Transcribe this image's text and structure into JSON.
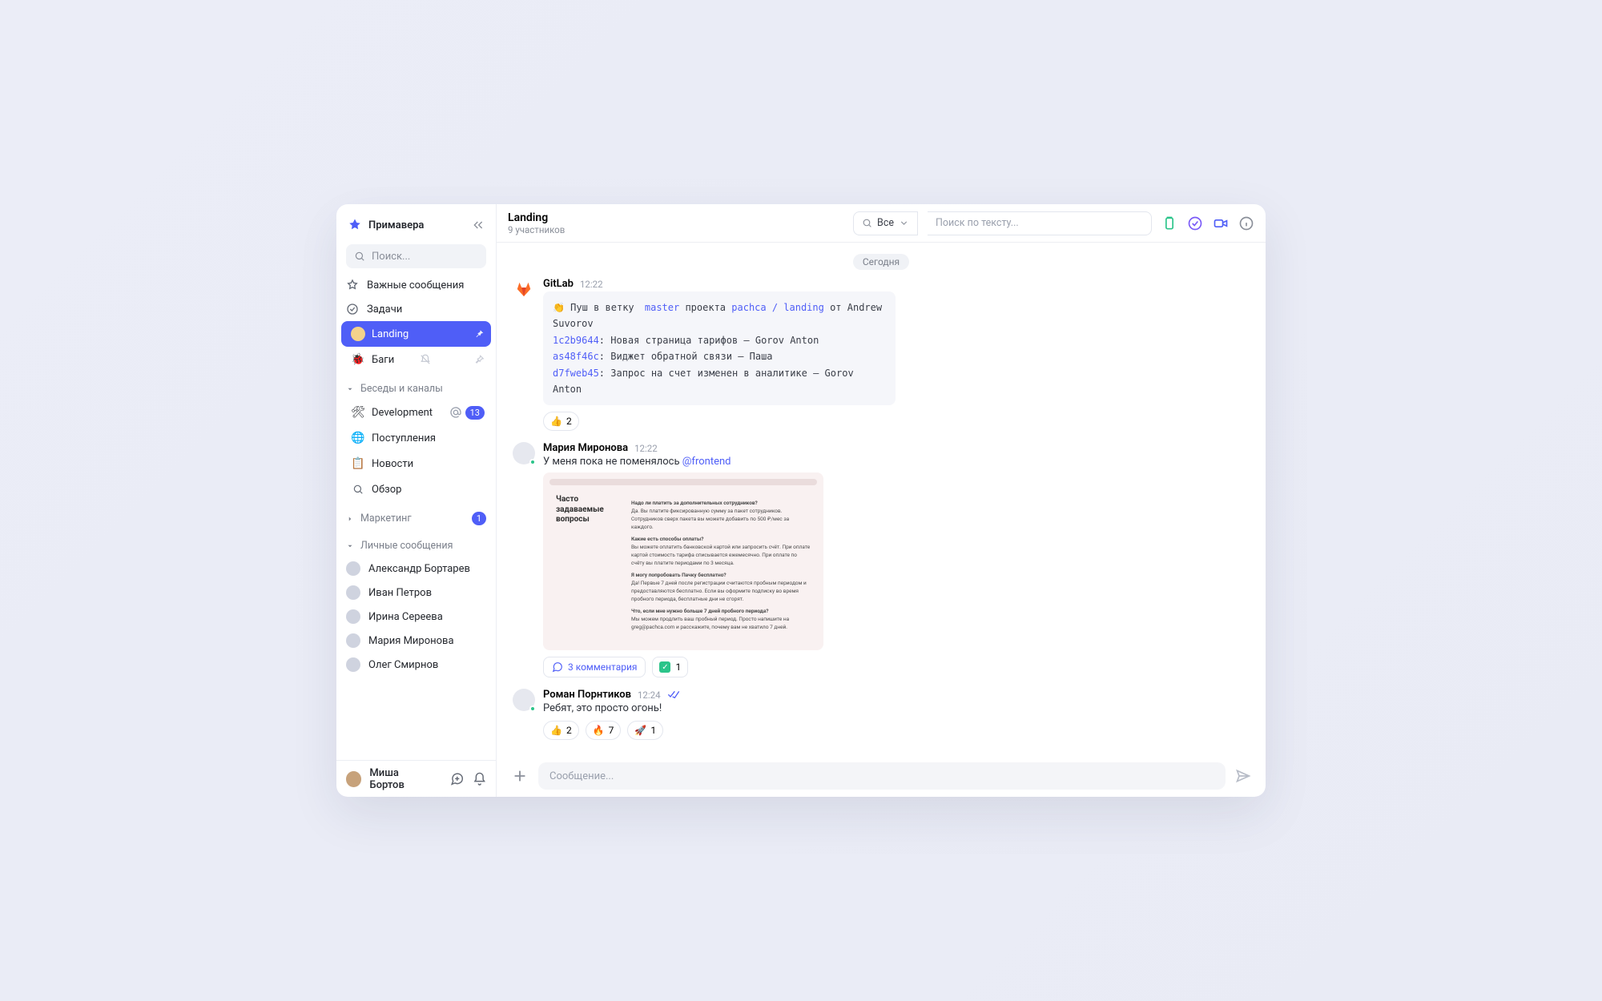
{
  "workspace": {
    "name": "Примавера"
  },
  "sidebar": {
    "search_placeholder": "Поиск...",
    "important": "Важные сообщения",
    "tasks": "Задачи",
    "section_channels": "Беседы и каналы",
    "section_marketing": "Маркетинг",
    "section_dm": "Личные сообщения",
    "channels": {
      "landing": {
        "label": "Landing",
        "emoji": "🌕"
      },
      "bugs": {
        "label": "Баги",
        "emoji": "🐞"
      },
      "dev": {
        "label": "Development",
        "emoji": "🛠",
        "badge": "13"
      },
      "inbox": {
        "label": "Поступления",
        "emoji": "🌐"
      },
      "news": {
        "label": "Новости",
        "emoji": "📋"
      },
      "review": {
        "label": "Обзор",
        "emoji": ""
      }
    },
    "marketing_badge": "1",
    "dms": [
      {
        "name": "Александр Бортарев"
      },
      {
        "name": "Иван Петров"
      },
      {
        "name": "Ирина Сереева"
      },
      {
        "name": "Мария Миронова"
      },
      {
        "name": "Олег Смирнов"
      }
    ],
    "me": "Миша Бортов"
  },
  "header": {
    "title": "Landing",
    "subtitle": "9 участников",
    "filter_label": "Все",
    "search_placeholder": "Поиск по тексту..."
  },
  "day_label": "Сегодня",
  "messages": {
    "gitlab": {
      "name": "GitLab",
      "time": "12:22",
      "push_prefix": "👏  Пуш в ветку ",
      "branch": "master",
      "mid": " проекта ",
      "project": "pachca / landing",
      "suffix": " от Andrew Suvorov",
      "commits": [
        {
          "sha": "1c2b9644",
          "rest": ": Новая страница тарифов – Gorov Anton"
        },
        {
          "sha": "as48f46c",
          "rest": ": Виджет обратной связи – Паша"
        },
        {
          "sha": "d7fweb45",
          "rest": ": Запрос на счет изменен в аналитике – Gorov Anton"
        }
      ],
      "react_thumb": "2"
    },
    "maria": {
      "name": "Мария Миронова",
      "time": "12:22",
      "text": "У меня пока не поменялось ",
      "mention": "@frontend",
      "faq_title": "Часто задаваемые вопросы",
      "thread": "3 комментария",
      "green_count": "1"
    },
    "roman": {
      "name": "Роман Порнтиков",
      "time": "12:24",
      "text": "Ребят, это просто огонь!",
      "react_thumb": "2",
      "react_fire": "7",
      "react_rocket": "1"
    }
  },
  "composer": {
    "placeholder": "Сообщение..."
  }
}
